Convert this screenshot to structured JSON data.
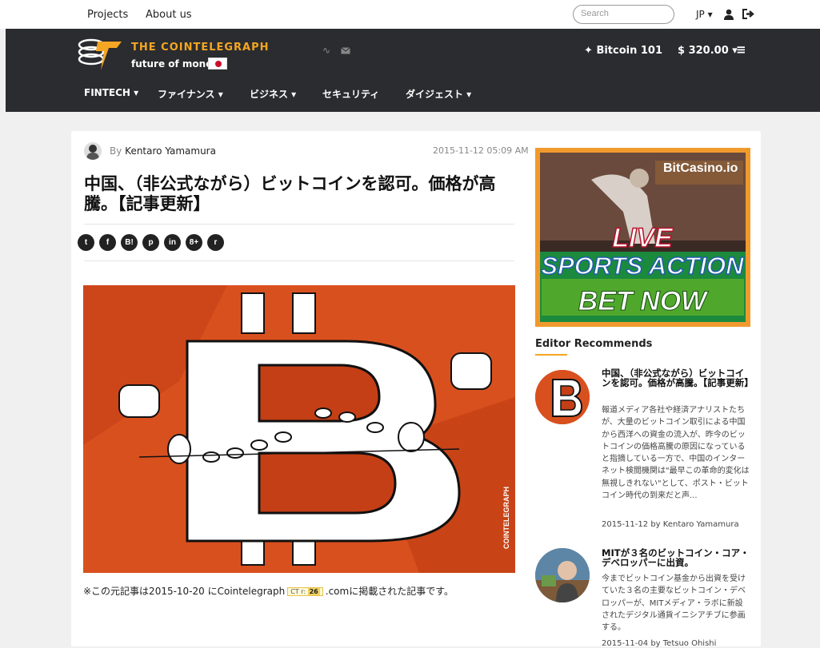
{
  "topbar": {
    "projects": "Projects",
    "about": "About us",
    "search_placeholder": "Search",
    "lang": "JP ▾"
  },
  "header": {
    "brand_title": "THE COINTELEGRAPH",
    "brand_sub": "future of money",
    "bitcoin101": "Bitcoin 101",
    "price": "$ 320.00 ▾"
  },
  "nav": [
    {
      "label": "FINTECH ▾"
    },
    {
      "label": "ファイナンス ▾"
    },
    {
      "label": "ビジネス ▾"
    },
    {
      "label": "セキュリティ"
    },
    {
      "label": "ダイジェスト ▾"
    }
  ],
  "article": {
    "by": "By",
    "author": "Kentaro Yamamura",
    "date": "2015-11-12 05:09 AM",
    "title": "中国、（非公式ながら）ビットコインを認可。価格が高騰。【記事更新】",
    "share": [
      "t",
      "f",
      "B!",
      "p",
      "in",
      "8+",
      "r"
    ],
    "caption_pre": "※この元記事は2015-10-20 にCointelegraph",
    "ct_label": "CT r:",
    "ct_value": "26",
    "caption_post": ".comに掲載された記事です。",
    "watermark": "COINTELEGRAPH"
  },
  "ad": {
    "brand": "BitCasino.io",
    "line1": "LIVE",
    "line2": "SPORTS ACTION",
    "line3": "BET NOW"
  },
  "sidebar": {
    "heading": "Editor Recommends",
    "items": [
      {
        "title": "中国、（非公式ながら）ビットコインを認可。価格が高騰。【記事更新】",
        "body": "報道メディア各社や経済アナリストたちが、大量のビットコイン取引による中国から西洋への資金の流入が、昨今のビットコインの価格高騰の原因になっていると指摘している一方で、中国のインターネット検閲機関は\"最早この革命的変化は無視しきれない\"として、ポスト・ビットコイン時代の到来だと声...",
        "date": "2015-11-12",
        "by": "by",
        "author": "Kentaro Yamamura"
      },
      {
        "title": "MITが３名のビットコイン・コア・デベロッパーに出資。",
        "body": "今までビットコイン基金から出資を受けていた３名の主要なビットコイン・デベロッパーが、MITメディア・ラボに新設されたデジタル通貨イニシアチブに参画する。",
        "date": "2015-11-04",
        "by": "by",
        "author": "Tetsuo Ohishi"
      }
    ]
  }
}
